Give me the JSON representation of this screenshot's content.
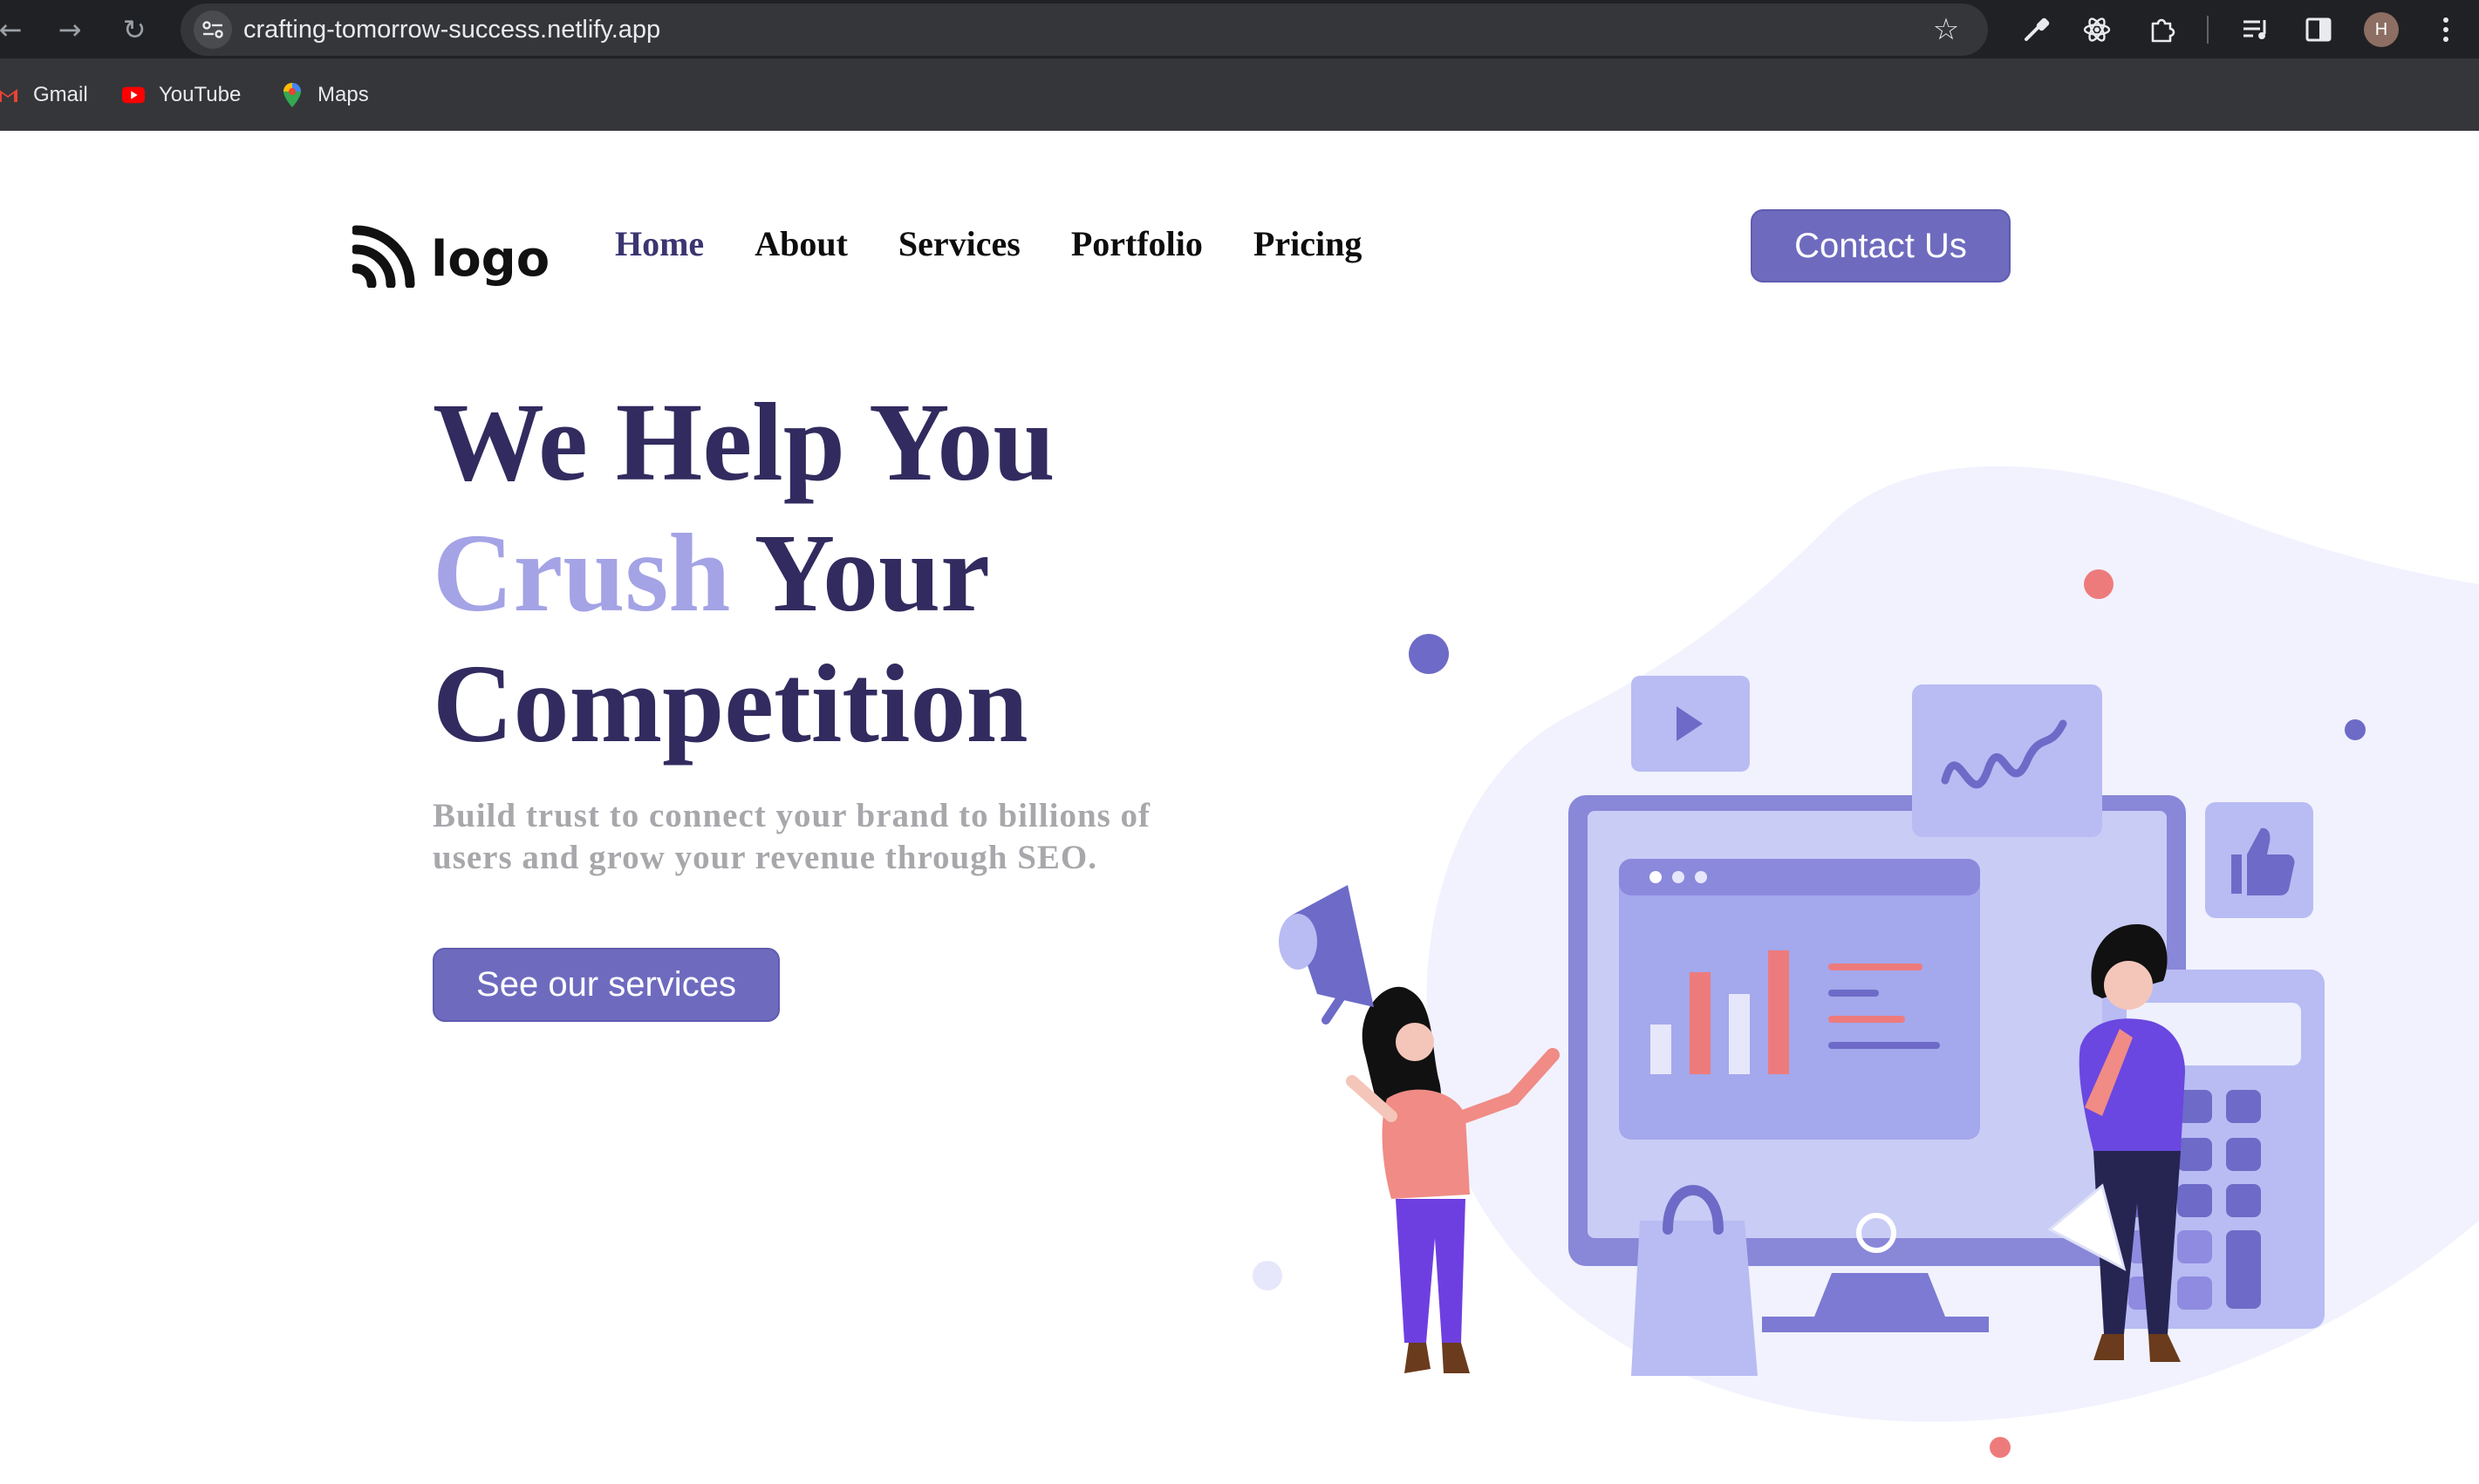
{
  "browser": {
    "url": "crafting-tomorrow-success.netlify.app",
    "avatar_initial": "H",
    "bookmarks": [
      {
        "label": "Gmail",
        "icon": "gmail-icon"
      },
      {
        "label": "YouTube",
        "icon": "youtube-icon"
      },
      {
        "label": "Maps",
        "icon": "maps-icon"
      }
    ]
  },
  "site": {
    "logo_text": "logo",
    "nav": [
      {
        "label": "Home",
        "active": true
      },
      {
        "label": "About"
      },
      {
        "label": "Services"
      },
      {
        "label": "Portfolio"
      },
      {
        "label": "Pricing"
      }
    ],
    "contact_label": "Contact Us"
  },
  "hero": {
    "title_line1": "We Help You",
    "title_accent": "Crush",
    "title_line2_rest": "Your",
    "title_line3": "Competition",
    "subtitle_line1": "Build trust to connect your brand to billions of",
    "subtitle_line2": "users and grow your revenue through SEO.",
    "cta_label": "See our services"
  },
  "colors": {
    "brand_purple": "#6e6bbf",
    "title_dark": "#322b5f",
    "title_accent": "#a4a3e6",
    "subtitle_gray": "#a8a8ac"
  }
}
